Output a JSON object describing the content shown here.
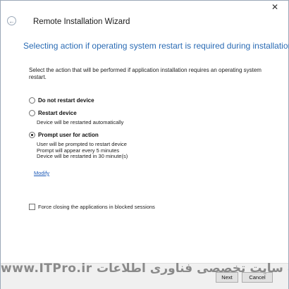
{
  "window": {
    "title": "Remote Installation Wizard",
    "close_glyph": "✕",
    "back_glyph": "←"
  },
  "heading": "Selecting action if operating system restart is required during installation",
  "description": "Select the action that will be performed if application installation requires an operating system restart.",
  "options": [
    {
      "label": "Do not restart device",
      "selected": false
    },
    {
      "label": "Restart device",
      "selected": false,
      "details": [
        "Device will be restarted automatically"
      ]
    },
    {
      "label": "Prompt user for action",
      "selected": true,
      "details": [
        "User will be prompted to restart device",
        "Prompt will appear every 5 minutes",
        "Device will be restarted in 30 minute(s)"
      ]
    }
  ],
  "modify_link": "Modify",
  "force_close": {
    "label": "Force closing the applications in blocked sessions",
    "checked": false
  },
  "buttons": {
    "next": "Next",
    "cancel": "Cancel"
  },
  "watermark": "www.ITPro.ir  وب سایت تخصصی فناوری اطلاعات"
}
